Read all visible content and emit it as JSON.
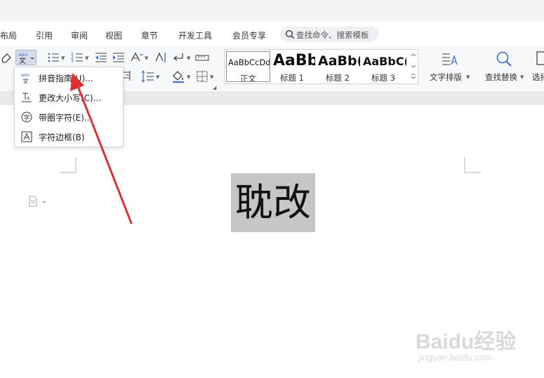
{
  "menu": {
    "items": [
      "布局",
      "引用",
      "审阅",
      "视图",
      "章节",
      "开发工具",
      "会员专享"
    ],
    "search_placeholder": "查找命令、搜索模板"
  },
  "toolbar": {
    "pinyin_glyph": "wén\n文",
    "gallery": {
      "styles": [
        {
          "sample": "AaBbCcDd",
          "name": "正文"
        },
        {
          "sample": "AaBb",
          "name": "标题 1"
        },
        {
          "sample": "AaBb(",
          "name": "标题 2"
        },
        {
          "sample": "AaBbC(",
          "name": "标题 3"
        }
      ]
    },
    "text_layout_label": "文字排版",
    "find_replace_label": "查找替换",
    "select_label": "选择"
  },
  "dropdown": {
    "items": [
      {
        "label": "拼音指南(U)...",
        "icon": "pinyin-icon"
      },
      {
        "label": "更改大小写(C)...",
        "icon": "change-case-icon"
      },
      {
        "label": "带圈字符(E)...",
        "icon": "enclosed-char-icon"
      },
      {
        "label": "字符边框(B)",
        "icon": "char-border-icon"
      }
    ]
  },
  "document": {
    "text": "耽改"
  },
  "watermark": {
    "main": "Baidu经验",
    "sub": "jingyan.baidu.com"
  },
  "colors": {
    "arrow": "#e03030",
    "accent": "#3a6bd8",
    "selection": "#c6c6c6"
  }
}
